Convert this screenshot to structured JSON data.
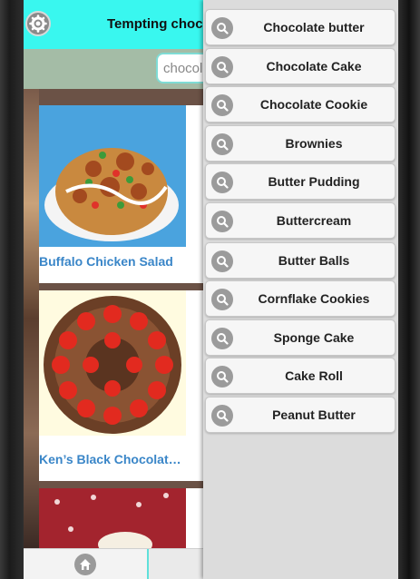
{
  "header": {
    "title": "Tempting choco",
    "settings_icon": "gear-icon"
  },
  "search": {
    "value": "chocol"
  },
  "recipes": [
    {
      "title": "Buffalo Chicken Salad"
    },
    {
      "title": "Ken’s Black Chocolat…"
    },
    {
      "title": ""
    }
  ],
  "bottom_bar": {
    "home_icon": "home-icon"
  },
  "suggestions": [
    {
      "label": "Chocolate butter",
      "icon": "search-icon"
    },
    {
      "label": "Chocolate Cake",
      "icon": "search-icon"
    },
    {
      "label": "Chocolate Cookie",
      "icon": "search-icon"
    },
    {
      "label": "Brownies",
      "icon": "search-icon"
    },
    {
      "label": "Butter Pudding",
      "icon": "search-icon"
    },
    {
      "label": "Buttercream",
      "icon": "search-icon"
    },
    {
      "label": "Butter Balls",
      "icon": "search-icon"
    },
    {
      "label": "Cornflake Cookies",
      "icon": "search-icon"
    },
    {
      "label": "Sponge Cake",
      "icon": "search-icon"
    },
    {
      "label": "Cake Roll",
      "icon": "search-icon"
    },
    {
      "label": "Peanut Butter",
      "icon": "search-icon"
    }
  ],
  "colors": {
    "header_bg": "#39f7ef",
    "link": "#3a86c8",
    "search_strip": "#a4bca6"
  }
}
